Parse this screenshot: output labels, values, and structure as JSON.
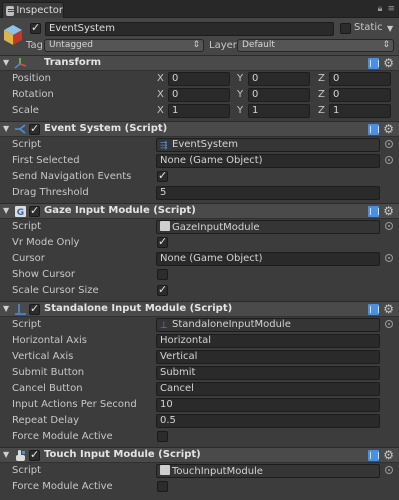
{
  "tab": {
    "label": "Inspector"
  },
  "header": {
    "name": "EventSystem",
    "static_label": "Static",
    "tag_label": "Tag",
    "tag_value": "Untagged",
    "layer_label": "Layer",
    "layer_value": "Default"
  },
  "transform": {
    "title": "Transform",
    "rows": [
      {
        "label": "Position",
        "x": "0",
        "y": "0",
        "z": "0"
      },
      {
        "label": "Rotation",
        "x": "0",
        "y": "0",
        "z": "0"
      },
      {
        "label": "Scale",
        "x": "1",
        "y": "1",
        "z": "1"
      }
    ],
    "axis": {
      "x": "X",
      "y": "Y",
      "z": "Z"
    }
  },
  "event_system": {
    "title": "Event System (Script)",
    "script_label": "Script",
    "script_value": "EventSystem",
    "first_selected_label": "First Selected",
    "first_selected_value": "None (Game Object)",
    "send_nav_label": "Send Navigation Events",
    "send_nav_checked": true,
    "drag_threshold_label": "Drag Threshold",
    "drag_threshold_value": "5"
  },
  "gaze": {
    "title": "Gaze Input Module (Script)",
    "script_label": "Script",
    "script_value": "GazeInputModule",
    "vr_mode_label": "Vr Mode Only",
    "vr_mode_checked": true,
    "cursor_label": "Cursor",
    "cursor_value": "None (Game Object)",
    "show_cursor_label": "Show Cursor",
    "show_cursor_checked": false,
    "scale_cursor_label": "Scale Cursor Size",
    "scale_cursor_checked": true
  },
  "standalone": {
    "title": "Standalone Input Module (Script)",
    "script_label": "Script",
    "script_value": "StandaloneInputModule",
    "rows": [
      {
        "label": "Horizontal Axis",
        "value": "Horizontal"
      },
      {
        "label": "Vertical Axis",
        "value": "Vertical"
      },
      {
        "label": "Submit Button",
        "value": "Submit"
      },
      {
        "label": "Cancel Button",
        "value": "Cancel"
      },
      {
        "label": "Input Actions Per Second",
        "value": "10"
      },
      {
        "label": "Repeat Delay",
        "value": "0.5"
      }
    ],
    "force_label": "Force Module Active",
    "force_checked": false
  },
  "touch": {
    "title": "Touch Input Module (Script)",
    "script_label": "Script",
    "script_value": "TouchInputModule",
    "force_label": "Force Module Active",
    "force_checked": false
  },
  "colors": {
    "panel": "#3c3c3c",
    "header": "#4a4a4a",
    "field": "#2a2a2a",
    "accent_blue": "#4a90e2"
  }
}
